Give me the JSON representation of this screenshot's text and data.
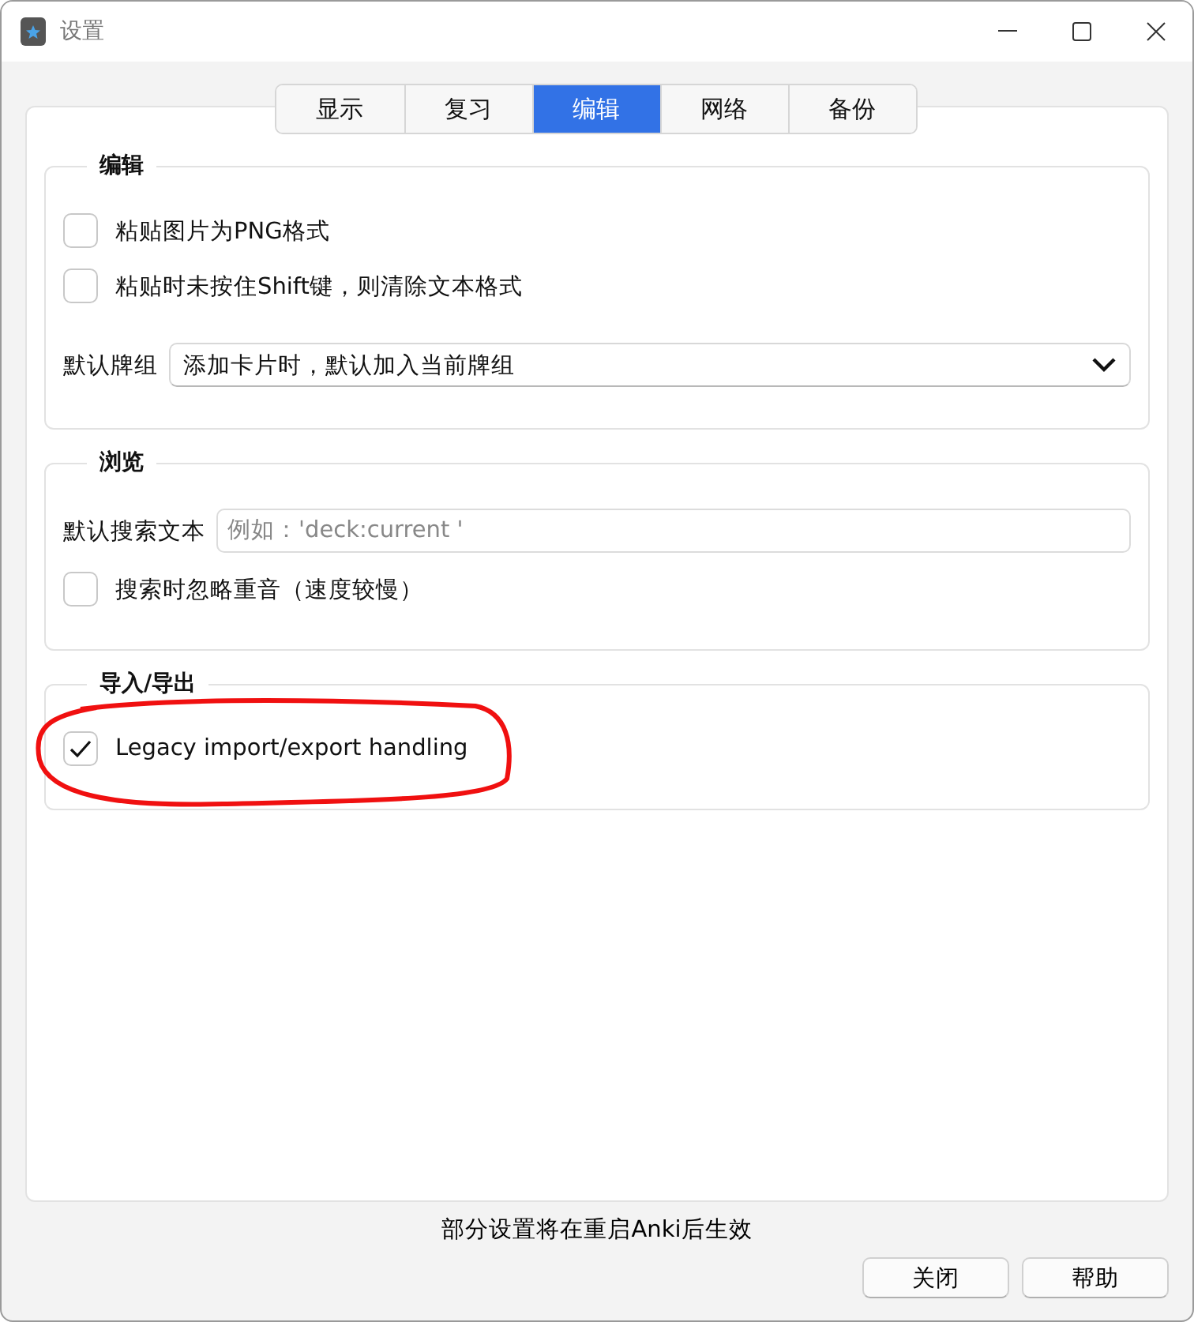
{
  "window": {
    "title": "设置"
  },
  "tabs": [
    {
      "label": "显示",
      "selected": false
    },
    {
      "label": "复习",
      "selected": false
    },
    {
      "label": "编辑",
      "selected": true
    },
    {
      "label": "网络",
      "selected": false
    },
    {
      "label": "备份",
      "selected": false
    }
  ],
  "groups": [
    {
      "title": "编辑",
      "items": [
        {
          "kind": "checkbox",
          "label": "粘贴图片为PNG格式",
          "checked": false
        },
        {
          "kind": "checkbox",
          "label": "粘贴时未按住Shift键，则清除文本格式",
          "checked": false
        },
        {
          "kind": "select",
          "label": "默认牌组",
          "value": "添加卡片时，默认加入当前牌组"
        }
      ]
    },
    {
      "title": "浏览",
      "items": [
        {
          "kind": "text",
          "label": "默认搜索文本",
          "placeholder": "例如：'deck:current '"
        },
        {
          "kind": "checkbox",
          "label": "搜索时忽略重音（速度较慢）",
          "checked": false
        }
      ]
    },
    {
      "title": "导入/导出",
      "items": [
        {
          "kind": "checkbox",
          "label": "Legacy import/export handling",
          "checked": true
        }
      ]
    }
  ],
  "footer_note": "部分设置将在重启Anki后生效",
  "buttons": [
    "关闭",
    "帮助"
  ]
}
